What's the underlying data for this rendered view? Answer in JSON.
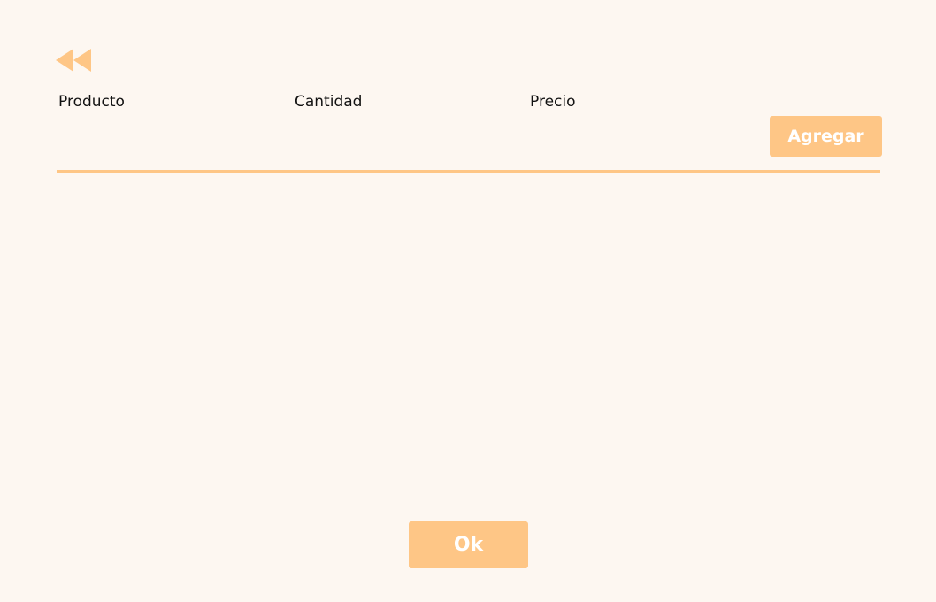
{
  "nav": {
    "back_icon": "double-chevron-left-icon"
  },
  "table": {
    "headers": [
      "Producto",
      "Cantidad",
      "Precio"
    ],
    "rows": []
  },
  "actions": {
    "add_label": "Agregar",
    "ok_label": "Ok"
  },
  "colors": {
    "background": "#fdf7f1",
    "accent": "#fec686",
    "button_text": "#ffffff",
    "text": "#111111"
  }
}
